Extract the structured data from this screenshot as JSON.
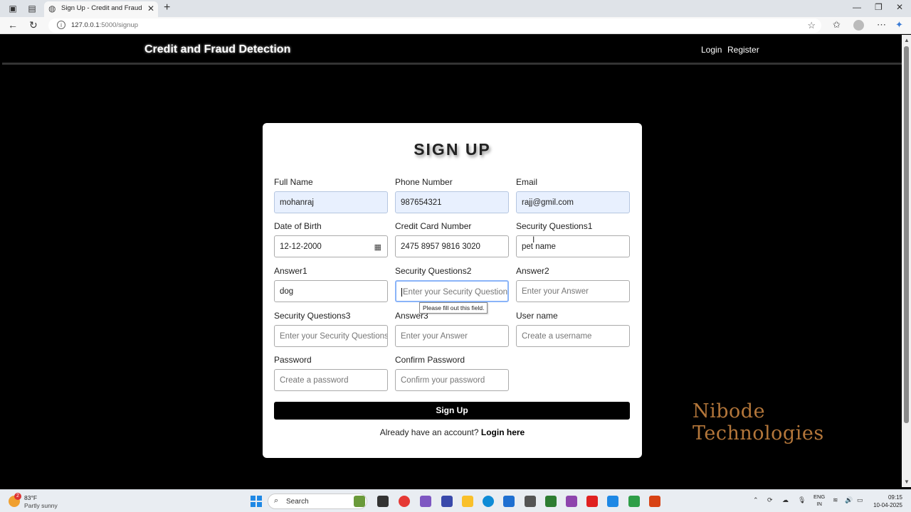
{
  "browser": {
    "tab_title": "Sign Up - Credit and Fraud Detec",
    "url_host": "127.0.0.1",
    "url_rest": ":5000/signup"
  },
  "navbar": {
    "brand": "Credit and Fraud Detection",
    "links": [
      "Login",
      "Register"
    ]
  },
  "form": {
    "title": "SIGN UP",
    "fields": [
      {
        "label": "Full Name",
        "value": "mohanraj",
        "placeholder": ""
      },
      {
        "label": "Phone Number",
        "value": "987654321",
        "placeholder": ""
      },
      {
        "label": "Email",
        "value": "rajj@gmil.com",
        "placeholder": ""
      },
      {
        "label": "Date of Birth",
        "value": "12-12-2000",
        "placeholder": ""
      },
      {
        "label": "Credit Card Number",
        "value": "2475 8957 9816 3020",
        "placeholder": ""
      },
      {
        "label": "Security Questions1",
        "value": "pet name",
        "placeholder": ""
      },
      {
        "label": "Answer1",
        "value": "dog",
        "placeholder": ""
      },
      {
        "label": "Security Questions2",
        "value": "",
        "placeholder": "Enter your Security Questions"
      },
      {
        "label": "Answer2",
        "value": "",
        "placeholder": "Enter your Answer"
      },
      {
        "label": "Security Questions3",
        "value": "",
        "placeholder": "Enter your Security Questions"
      },
      {
        "label": "Answer3",
        "value": "",
        "placeholder": "Enter your Answer"
      },
      {
        "label": "User name",
        "value": "",
        "placeholder": "Create a username"
      },
      {
        "label": "Password",
        "value": "",
        "placeholder": "Create a password"
      },
      {
        "label": "Confirm Password",
        "value": "",
        "placeholder": "Confirm your password"
      }
    ],
    "validation_tooltip": "Please fill out this field.",
    "submit_label": "Sign Up",
    "login_prompt": "Already have an account?",
    "login_link": "Login here"
  },
  "watermark": "Nibode Technologies",
  "taskbar": {
    "weather_temp": "83°F",
    "weather_desc": "Partly sunny",
    "weather_badge": "2",
    "search_label": "Search",
    "lang_line1": "ENG",
    "lang_line2": "IN",
    "time": "09:15",
    "date": "10-04-2025"
  }
}
